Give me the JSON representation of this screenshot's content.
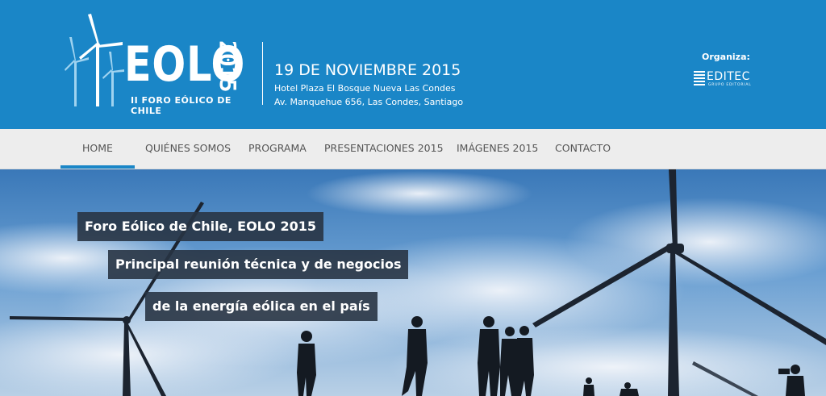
{
  "header": {
    "logo": {
      "word": "EOLO",
      "year": "2015",
      "subtitle": "II FORO EÓLICO DE CHILE"
    },
    "event": {
      "date": "19 DE NOVIEMBRE 2015",
      "venue": "Hotel Plaza El Bosque Nueva Las Condes Av. Manquehue 656, Las Condes, Santiago"
    },
    "organizer": {
      "label": "Organiza:",
      "name": "EDITEC",
      "tagline": "GRUPO EDITORIAL"
    }
  },
  "nav": {
    "items": [
      {
        "label": "HOME",
        "active": true
      },
      {
        "label": "QUIÉNES SOMOS",
        "active": false
      },
      {
        "label": "PROGRAMA",
        "active": false
      },
      {
        "label": "PRESENTACIONES 2015",
        "active": false
      },
      {
        "label": "IMÁGENES 2015",
        "active": false
      },
      {
        "label": "CONTACTO",
        "active": false
      }
    ]
  },
  "hero": {
    "captions": [
      "Foro Eólico de Chile, EOLO 2015",
      "Principal reunión técnica y de negocios",
      "de la energía eólica en el país"
    ]
  },
  "colors": {
    "header_bg": "#1a86c7",
    "nav_bg": "#ededed",
    "active_underline": "#1a86c7",
    "caption_bg": "#283444"
  }
}
